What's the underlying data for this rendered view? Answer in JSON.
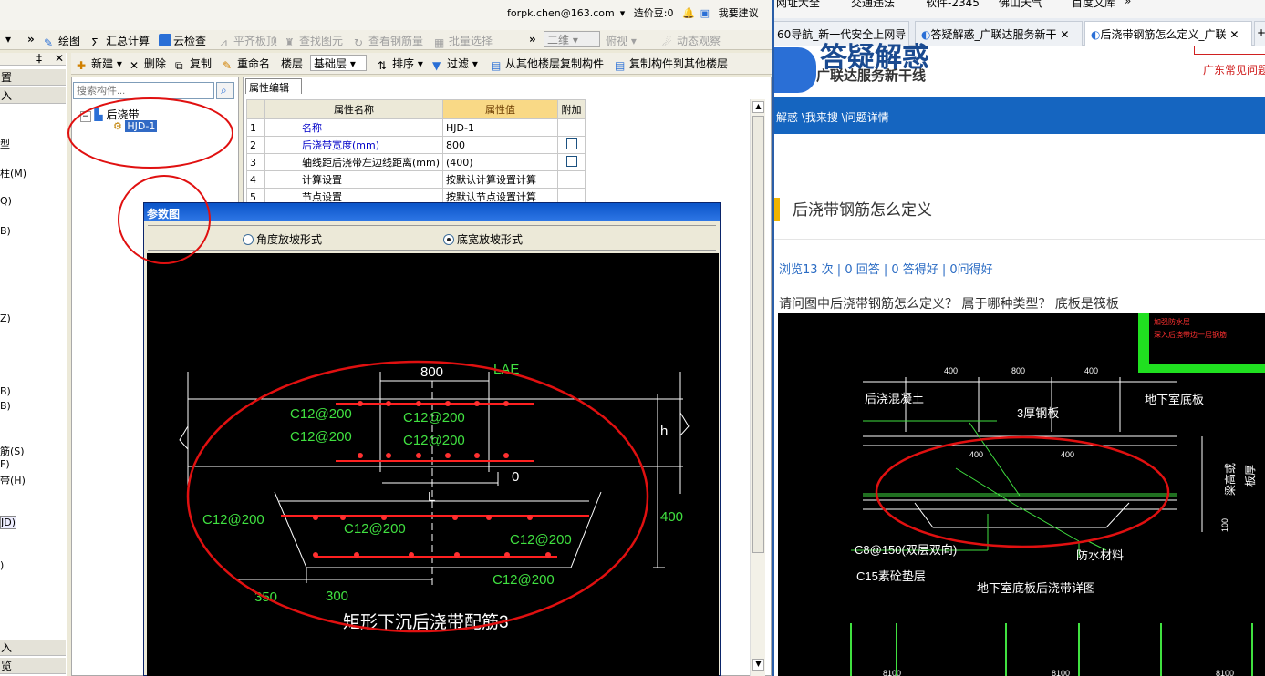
{
  "topbar": {
    "email": "forpk.chen@163.com",
    "beans": "造价豆:0",
    "feedback": "我要建议"
  },
  "toolbar1": {
    "chevron": "»",
    "items": [
      {
        "label": "绘图",
        "disabled": false
      },
      {
        "label": "汇总计算",
        "disabled": false
      },
      {
        "label": "云检查",
        "disabled": false
      },
      {
        "label": "平齐板顶",
        "disabled": true
      },
      {
        "label": "查找图元",
        "disabled": true
      },
      {
        "label": "查看钢筋量",
        "disabled": true
      },
      {
        "label": "批量选择",
        "disabled": true
      }
    ],
    "view_select": "二维",
    "view_items": [
      {
        "label": "俯视",
        "disabled": true
      },
      {
        "label": "动态观察",
        "disabled": true
      }
    ]
  },
  "toolbar2": {
    "items": [
      "新建",
      "删除",
      "复制",
      "重命名"
    ],
    "floor_label": "楼层",
    "floor_value": "基础层",
    "sort": "排序",
    "filter": "过滤",
    "copy_from": "从其他楼层复制构件",
    "copy_to": "复制构件到其他楼层"
  },
  "leftnav": {
    "bars": [
      "置",
      "入"
    ],
    "items": [
      "型",
      "柱(M)",
      "Q)",
      "B)",
      "Z)",
      "B)",
      "B)",
      "筋(S)",
      "F)",
      "带(H)",
      "JD)",
      ")"
    ],
    "bottom_bars": [
      "入",
      "览"
    ]
  },
  "tree": {
    "search_placeholder": "搜索构件...",
    "root": "后浇带",
    "child": "HJD-1"
  },
  "props": {
    "tab": "属性编辑",
    "headers": [
      "属性名称",
      "属性值",
      "附加"
    ],
    "rows": [
      {
        "n": "1",
        "name": "名称",
        "value": "HJD-1",
        "check": false,
        "blue": true
      },
      {
        "n": "2",
        "name": "后浇带宽度(mm)",
        "value": "800",
        "check": true,
        "blue": true
      },
      {
        "n": "3",
        "name": "轴线距后浇带左边线距离(mm)",
        "value": "(400)",
        "check": true,
        "blue": false
      },
      {
        "n": "4",
        "name": "计算设置",
        "value": "按默认计算设置计算",
        "check": false,
        "blue": false
      },
      {
        "n": "5",
        "name": "节点设置",
        "value": "按默认节点设置计算",
        "check": false,
        "blue": false
      }
    ]
  },
  "dialog": {
    "title": "参数图",
    "radio1": "角度放坡形式",
    "radio2": "底宽放坡形式",
    "selected": 2,
    "cad": {
      "dim_800": "800",
      "lae": "LAE",
      "rebar": [
        "C12@200",
        "C12@200",
        "C12@200",
        "C12@200",
        "C12@200",
        "C12@200",
        "C12@200",
        "C12@200"
      ],
      "h": "h",
      "zero": "0",
      "L": "L",
      "dim_400": "400",
      "dim_350": "350",
      "dim_300": "300",
      "caption": "矩形下沉后浇带配筋3"
    }
  },
  "browser": {
    "bookmarks": [
      "网址大全",
      "交通违法",
      "软件-2345",
      "佛山天气",
      "百度文库",
      "»"
    ],
    "tabs": [
      "60导航_新一代安全上网导",
      "答疑解惑_广联达服务新干",
      "后浇带钢筋怎么定义_广联"
    ],
    "logo_big": "答疑解惑",
    "logo_sub": "广联达服务新干线",
    "logo_right": "广东常见问题",
    "breadcrumb": "解惑 \\我来搜 \\问题详情",
    "title": "后浇带钢筋怎么定义",
    "stats": "浏览13 次 | 0 回答 | 0 答得好 | 0问得好",
    "question": "请问图中后浇带钢筋怎么定义？ 属于哪种类型？ 底板是筏板",
    "cad": {
      "top_dims": [
        "400",
        "800",
        "400"
      ],
      "label_concrete": "后浇混凝土",
      "label_plate": "3厚钢板",
      "label_floor": "地下室底板",
      "mid_dims": [
        "400",
        "400"
      ],
      "label_beam": "梁高或",
      "label_thick": "板厚",
      "label_rebar": "C8@150(双层双向)",
      "label_cushion": "C15素砼垫层",
      "label_waterproof": "防水材料",
      "caption": "地下室底板后浇带详图",
      "side_dim": "100",
      "red_note1": "加强防水层",
      "red_note2": "深入后浇带边一层钢筋",
      "bottom_dims": [
        "8100",
        "8100",
        "8100"
      ]
    }
  }
}
